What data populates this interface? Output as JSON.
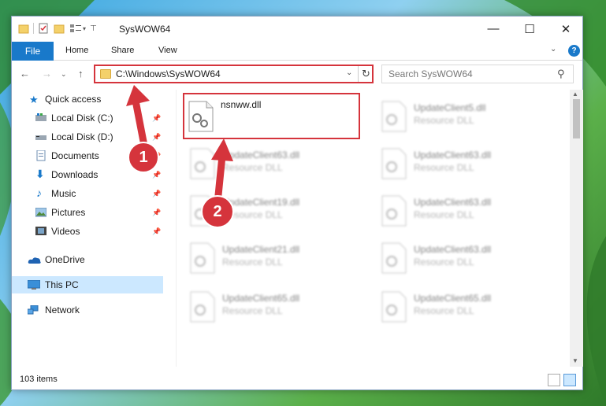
{
  "window": {
    "title": "SysWOW64"
  },
  "ribbon": {
    "file": "File",
    "tabs": [
      "Home",
      "Share",
      "View"
    ]
  },
  "address": {
    "path": "C:\\Windows\\SysWOW64"
  },
  "search": {
    "placeholder": "Search SysWOW64"
  },
  "nav": {
    "items": [
      {
        "label": "Quick access",
        "icon": "star-icon",
        "pinned": false
      },
      {
        "label": "Local Disk (C:)",
        "icon": "drive-icon",
        "pinned": true
      },
      {
        "label": "Local Disk (D:)",
        "icon": "drive-icon",
        "pinned": true
      },
      {
        "label": "Documents",
        "icon": "documents-icon",
        "pinned": true
      },
      {
        "label": "Downloads",
        "icon": "download-icon",
        "pinned": true
      },
      {
        "label": "Music",
        "icon": "music-icon",
        "pinned": true
      },
      {
        "label": "Pictures",
        "icon": "pictures-icon",
        "pinned": true
      },
      {
        "label": "Videos",
        "icon": "videos-icon",
        "pinned": true
      },
      {
        "label": "OneDrive",
        "icon": "cloud-icon",
        "pinned": false
      },
      {
        "label": "This PC",
        "icon": "computer-icon",
        "pinned": false,
        "selected": true
      },
      {
        "label": "Network",
        "icon": "network-icon",
        "pinned": false
      }
    ]
  },
  "files": [
    {
      "name": "nsnww.dll",
      "type": "",
      "highlighted": true
    },
    {
      "name": "UpdateClient5.dll",
      "type": "Resource DLL"
    },
    {
      "name": "UpdateClient63.dll",
      "type": "Resource DLL"
    },
    {
      "name": "UpdateClient63.dll",
      "type": "Resource DLL"
    },
    {
      "name": "UpdateClient19.dll",
      "type": "Resource DLL"
    },
    {
      "name": "UpdateClient63.dll",
      "type": "Resource DLL"
    },
    {
      "name": "UpdateClient21.dll",
      "type": "Resource DLL"
    },
    {
      "name": "UpdateClient63.dll",
      "type": "Resource DLL"
    },
    {
      "name": "UpdateClient65.dll",
      "type": "Resource DLL"
    },
    {
      "name": "UpdateClient65.dll",
      "type": "Resource DLL"
    }
  ],
  "status": {
    "count": "103 items"
  },
  "annotations": {
    "step1": "1",
    "step2": "2"
  },
  "colors": {
    "accent": "#1979ca",
    "highlight": "#d5343c",
    "selection": "#cce8ff"
  }
}
